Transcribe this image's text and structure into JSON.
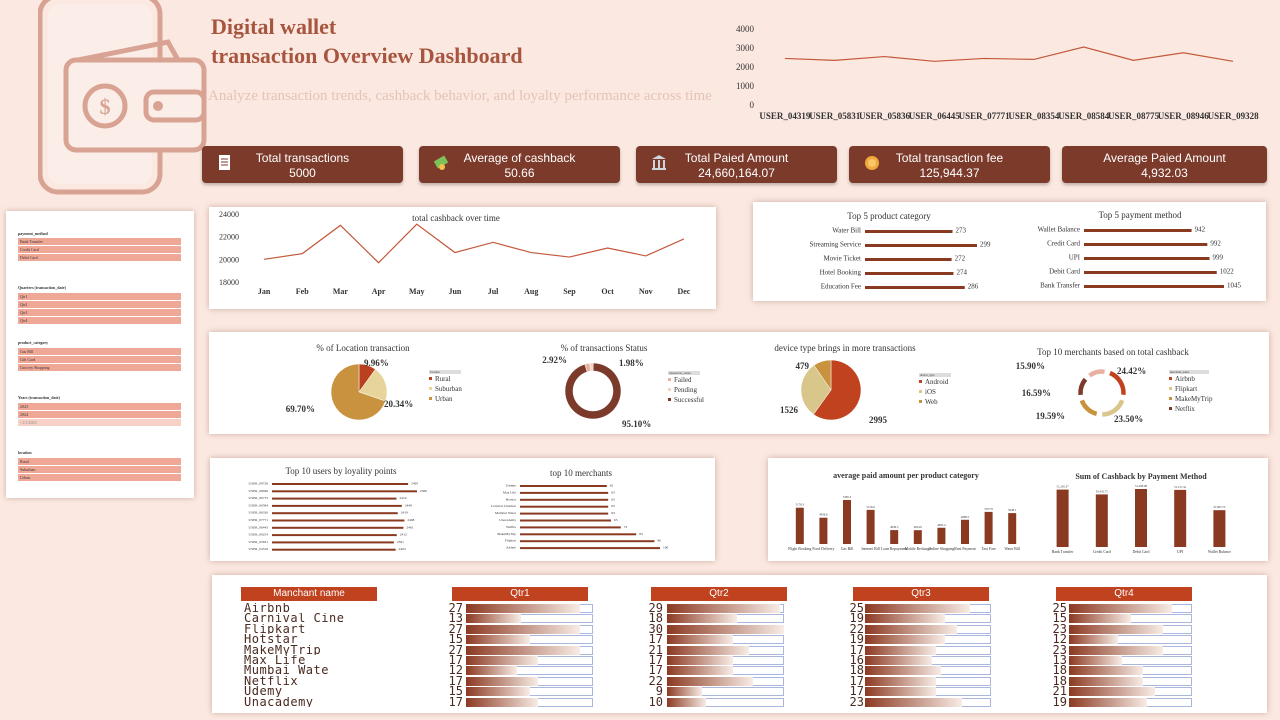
{
  "header": {
    "title_line1": "Digital wallet",
    "title_line2": "transaction Overview Dashboard",
    "subtitle": "Analyze transaction trends, cashback behavior, and loyalty performance across time"
  },
  "kpis": [
    {
      "label": "Total transactions",
      "value": "5000",
      "icon": "document-icon"
    },
    {
      "label": "Average of cashback",
      "value": "50.66",
      "icon": "money-icon"
    },
    {
      "label": "Total  Paied Amount",
      "value": "24,660,164.07",
      "icon": "bank-icon"
    },
    {
      "label": "Total transaction fee",
      "value": "125,944.37",
      "icon": "coin-icon"
    },
    {
      "label": "Average Paied Amount",
      "value": "4,932.03",
      "icon": ""
    }
  ],
  "slicers": [
    {
      "title": "payment_method",
      "items": [
        "Bank Transfer",
        "Credit Card",
        "Debit Card"
      ]
    },
    {
      "title": "Quarters (transaction_date)",
      "items": [
        "Qtr1",
        "Qtr2",
        "Qtr3",
        "Qtr4"
      ]
    },
    {
      "title": "product_category",
      "items": [
        "Gas Bill",
        "Gift Card",
        "Grocery Shopping"
      ]
    },
    {
      "title": "Years (transaction_date)",
      "items": [
        "2023",
        "2024",
        "<1/1/2023"
      ]
    },
    {
      "title": "location",
      "items": [
        "Rural",
        "Suburban",
        "Urban"
      ]
    }
  ],
  "chart_data": [
    {
      "id": "user_line",
      "type": "line",
      "categories": [
        "USER_04319",
        "USER_05831",
        "USER_05836",
        "USER_06445",
        "USER_07771",
        "USER_08354",
        "USER_08584",
        "USER_08775",
        "USER_08946",
        "USER_09328"
      ],
      "values": [
        2450,
        2350,
        2550,
        2300,
        2450,
        2400,
        3050,
        2350,
        2750,
        2300
      ],
      "yticks": [
        "4000",
        "3000",
        "2000",
        "1000",
        "0"
      ],
      "ylim": [
        0,
        4000
      ]
    },
    {
      "id": "cashback_time",
      "type": "line",
      "title": "total cashback over time",
      "categories": [
        "Jan",
        "Feb",
        "Mar",
        "Apr",
        "May",
        "Jun",
        "Jul",
        "Aug",
        "Sep",
        "Oct",
        "Nov",
        "Dec"
      ],
      "values": [
        20000,
        20500,
        23000,
        19700,
        23100,
        20600,
        21500,
        20600,
        20200,
        21000,
        20300,
        21800
      ],
      "yticks": [
        "24000",
        "22000",
        "20000",
        "18000"
      ],
      "ylim": [
        18000,
        24000
      ]
    },
    {
      "id": "top5_product",
      "type": "bar",
      "title": "Top 5 product category",
      "categories": [
        "Water Bill",
        "Streaming Service",
        "Movie Ticket",
        "Hotel Booking",
        "Education Fee"
      ],
      "values": [
        273,
        299,
        272,
        274,
        286
      ],
      "labels": [
        "273",
        "299",
        "272",
        "274",
        "286"
      ]
    },
    {
      "id": "top5_payment",
      "type": "bar",
      "title": "Top 5 payment method",
      "categories": [
        "Wallet Balance",
        "Credit Card",
        "UPI",
        "Debit Card",
        "Bank Transfer"
      ],
      "values": [
        942,
        992,
        999,
        1022,
        1045
      ],
      "labels": [
        "942",
        "992",
        "999",
        "1022",
        "1045"
      ]
    },
    {
      "id": "location_pie",
      "type": "pie",
      "title": "% of Location transaction",
      "legend_title": "location",
      "categories": [
        "Rural",
        "Suburban",
        "Urban"
      ],
      "values": [
        9.96,
        20.34,
        69.7
      ],
      "labels": [
        "9.96%",
        "20.34%",
        "69.70%"
      ]
    },
    {
      "id": "status_donut",
      "type": "pie",
      "title": "% of transactions Status",
      "legend_title": "transaction_status",
      "categories": [
        "Failed",
        "Pending",
        "Successful"
      ],
      "values": [
        2.92,
        1.98,
        95.1
      ],
      "labels": [
        "2.92%",
        "1.98%",
        "95.10%"
      ]
    },
    {
      "id": "device_pie",
      "type": "pie",
      "title": "device type brings in more transactions",
      "legend_title": "device_type",
      "categories": [
        "Android",
        "iOS",
        "Web"
      ],
      "values": [
        2995,
        1526,
        479
      ],
      "labels": [
        "2995",
        "1526",
        "479"
      ]
    },
    {
      "id": "merchant_donut",
      "type": "pie",
      "title": "Top 10 merchants based on total cashback",
      "legend_title": "merchant_name",
      "categories": [
        "Airbnb",
        "Flipkart",
        "MakeMyTrip",
        "Netflix"
      ],
      "values": [
        24.42,
        23.5,
        19.59,
        16.59,
        15.9
      ],
      "labels": [
        "24.42%",
        "23.50%",
        "19.59%",
        "16.59%",
        "15.90%"
      ]
    },
    {
      "id": "top10_users",
      "type": "bar",
      "title": "Top 10 users by loyality points",
      "categories": [
        "USER_09728",
        "USER_08046",
        "USER_06773",
        "USER_06584",
        "USER_06326",
        "USER_07771",
        "USER_06443",
        "USER_09254",
        "USER_05831",
        "USER_04319"
      ],
      "values": [
        2495,
        2560,
        2410,
        2449,
        2419,
        2468,
        2461,
        2412,
        2391,
        2404
      ],
      "labels": [
        "2495",
        "2560",
        "2410",
        "2449",
        "2419",
        "2468",
        "2461",
        "2412",
        "2391",
        "2404"
      ]
    },
    {
      "id": "top10_merchants",
      "type": "bar",
      "title": "top 10 merchants",
      "categories": [
        "Udemy",
        "Max Life",
        "Hotstar",
        "Carnival Cinemas",
        "Mumbai Water",
        "Unacademy",
        "Netflix",
        "MakeMyTrip",
        "Flipkart",
        "Airbnb"
      ],
      "values": [
        62,
        63,
        63,
        63,
        63,
        65,
        72,
        83,
        96,
        100
      ],
      "labels": [
        "62",
        "63",
        "63",
        "63",
        "63",
        "65",
        "72",
        "83",
        "96",
        "100"
      ]
    },
    {
      "id": "avg_paid_product",
      "type": "bar",
      "title": "average paid amount per product category",
      "categories": [
        "Flight Booking",
        "Food Delivery",
        "Gas Bill",
        "Internet Bill",
        "Loan Repayment",
        "Mobile Recharge",
        "Online Shopping",
        "Rent Payment",
        "Taxi Fare",
        "Water Bill"
      ],
      "values": [
        5178.3,
        4936.6,
        5365.3,
        5126.6,
        4636.5,
        4634.6,
        4693.4,
        4886.5,
        5077.8,
        5048.1
      ],
      "labels": [
        "5178.3",
        "4936.6",
        "5365.3",
        "5126.6",
        "4636.5",
        "4634.6",
        "4693.4",
        "4886.5",
        "5077.8",
        "5048.1"
      ]
    },
    {
      "id": "cashback_payment",
      "type": "bar",
      "title": "Sum of Cashback by Payment Method",
      "categories": [
        "Bank Transfer",
        "Credit Card",
        "Debit Card",
        "UPI",
        "Wallet Balance"
      ],
      "values": [
        51205.37,
        50432.75,
        51299.98,
        51157.41,
        47905.75
      ],
      "labels": [
        "51,205.37",
        "50,432.75",
        "51,299.98",
        "51,157.41",
        "47,905.75"
      ]
    }
  ],
  "merchant_table": {
    "header": "Manchant name",
    "quarters": [
      "Qtr1",
      "Qtr2",
      "Qtr3",
      "Qtr4"
    ],
    "merchants": [
      "Airbnb",
      "Carnival Cine",
      "Flipkart",
      "Hotstar",
      "MakeMyTrip",
      "Max Life",
      "Mumbai Wate",
      "Netflix",
      "Udemy",
      "Unacademy"
    ],
    "q1": [
      27,
      13,
      27,
      15,
      27,
      17,
      12,
      17,
      15,
      17
    ],
    "q2": [
      29,
      18,
      30,
      17,
      21,
      17,
      17,
      22,
      9,
      10
    ],
    "q3": [
      25,
      19,
      22,
      19,
      17,
      16,
      18,
      17,
      17,
      23
    ],
    "q4": [
      25,
      15,
      23,
      12,
      23,
      13,
      18,
      18,
      21,
      19
    ],
    "max": 30
  },
  "colors": {
    "accent": "#7c3a2b",
    "bar": "#8b3a22",
    "line": "#c4583a",
    "header": "#c0421f"
  }
}
